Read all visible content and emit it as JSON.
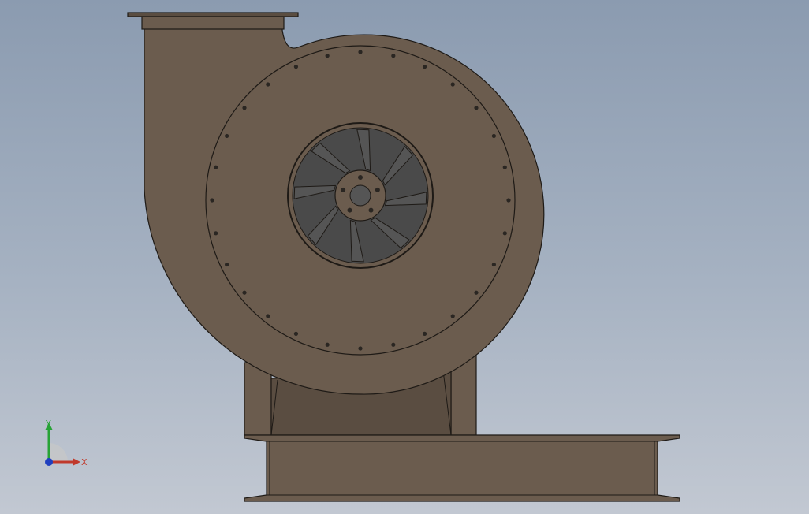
{
  "app": {
    "view": "CAD 3D viewport"
  },
  "model": {
    "icon_name": "centrifugal-fan-model",
    "colors": {
      "body": "#6b5c4e",
      "body_dark": "#5a4d41",
      "edge": "#1e1a16",
      "hub": "#4a4a4a",
      "blade": "#555555",
      "bolt": "#2a2622"
    }
  },
  "triad": {
    "x_label": "X",
    "y_label": "Y",
    "colors": {
      "x": "#c0392b",
      "y": "#27a336",
      "z": "#1f3fbf"
    }
  }
}
